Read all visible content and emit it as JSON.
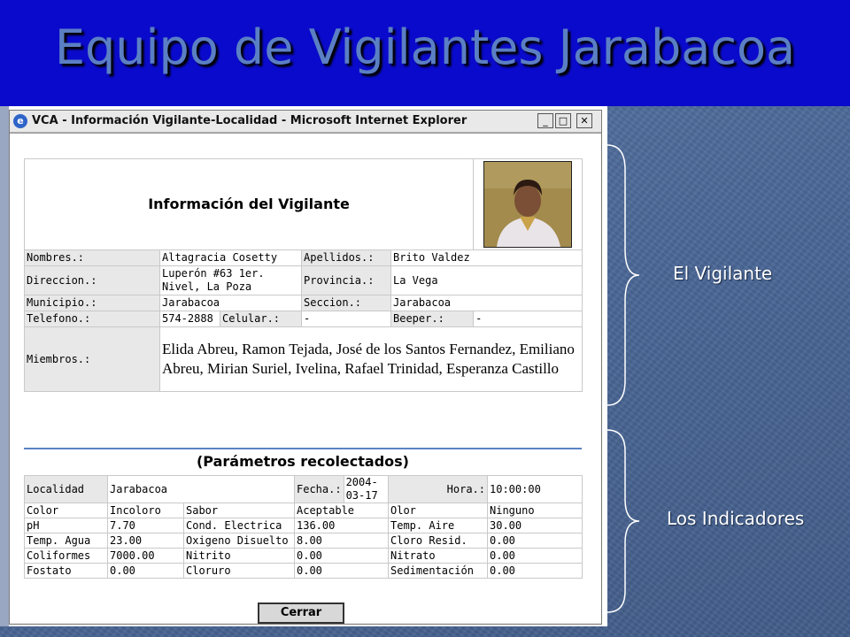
{
  "slide": {
    "title": "Equipo de Vigilantes Jarabacoa",
    "label_vigilante": "El Vigilante",
    "label_indicadores": "Los Indicadores"
  },
  "window": {
    "title": "VCA - Información Vigilante-Localidad - Microsoft Internet Explorer",
    "icon": "internet-explorer-icon",
    "buttons": [
      "_",
      "□",
      "✕"
    ]
  },
  "vigilante": {
    "heading": "Información del Vigilante",
    "fields": {
      "nombres_label": "Nombres.:",
      "nombres": "Altagracia Cosetty",
      "apellidos_label": "Apellidos.:",
      "apellidos": "Brito Valdez",
      "direccion_label": "Direccion.:",
      "direccion": "Luperón #63 1er. Nivel, La Poza",
      "provincia_label": "Provincia.:",
      "provincia": "La Vega",
      "municipio_label": "Municipio.:",
      "municipio": "Jarabacoa",
      "seccion_label": "Seccion.:",
      "seccion": "Jarabacoa",
      "telefono_label": "Telefono.:",
      "telefono": "574-2888",
      "celular_label": "Celular.:",
      "celular": "-",
      "beeper_label": "Beeper.:",
      "beeper": "-",
      "miembros_label": "Miembros.:",
      "miembros": "Elida Abreu, Ramon Tejada, José de los Santos Fernandez, Emiliano Abreu, Mirian Suriel, Ivelina, Rafael Trinidad, Esperanza Castillo"
    }
  },
  "parametros": {
    "heading": "(Parámetros recolectados)",
    "localidad_label": "Localidad",
    "localidad": "Jarabacoa",
    "fecha_label": "Fecha.:",
    "fecha": "2004-03-17",
    "hora_label": "Hora.:",
    "hora": "10:00:00",
    "rows": [
      [
        "Color",
        "Incoloro",
        "Sabor",
        "Aceptable",
        "Olor",
        "Ninguno"
      ],
      [
        "pH",
        "7.70",
        "Cond. Electrica",
        "136.00",
        "Temp. Aire",
        "30.00"
      ],
      [
        "Temp. Agua",
        "23.00",
        "Oxigeno Disuelto",
        "8.00",
        "Cloro Resid.",
        "0.00"
      ],
      [
        "Coliformes",
        "7000.00",
        "Nitrito",
        "0.00",
        "Nitrato",
        "0.00"
      ],
      [
        "Fostato",
        "0.00",
        "Cloruro",
        "0.00",
        "Sedimentación",
        "0.00"
      ]
    ]
  },
  "buttons": {
    "cerrar": "Cerrar"
  }
}
